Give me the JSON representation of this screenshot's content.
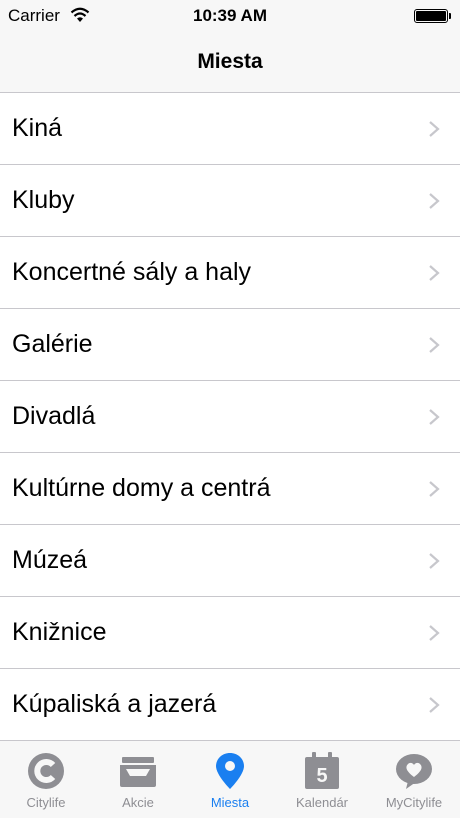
{
  "status_bar": {
    "carrier": "Carrier",
    "time": "10:39 AM",
    "battery_level": 1.0
  },
  "nav": {
    "title": "Miesta"
  },
  "list": [
    {
      "label": "Kiná"
    },
    {
      "label": "Kluby"
    },
    {
      "label": "Koncertné sály a haly"
    },
    {
      "label": "Galérie"
    },
    {
      "label": "Divadlá"
    },
    {
      "label": "Kultúrne domy a centrá"
    },
    {
      "label": "Múzeá"
    },
    {
      "label": "Knižnice"
    },
    {
      "label": "Kúpaliská a jazerá"
    }
  ],
  "tabs": [
    {
      "label": "Citylife",
      "icon": "citylife-logo-icon",
      "active": false
    },
    {
      "label": "Akcie",
      "icon": "inbox-tray-icon",
      "active": false
    },
    {
      "label": "Miesta",
      "icon": "location-pin-icon",
      "active": true
    },
    {
      "label": "Kalendár",
      "icon": "calendar-icon",
      "calendar_day": "5",
      "active": false
    },
    {
      "label": "MyCitylife",
      "icon": "heart-bubble-icon",
      "active": false
    }
  ],
  "colors": {
    "accent": "#1a7ff0",
    "inactive": "#8e8e93",
    "separator": "#c8c7cc",
    "bar_bg": "#f7f7f7"
  }
}
